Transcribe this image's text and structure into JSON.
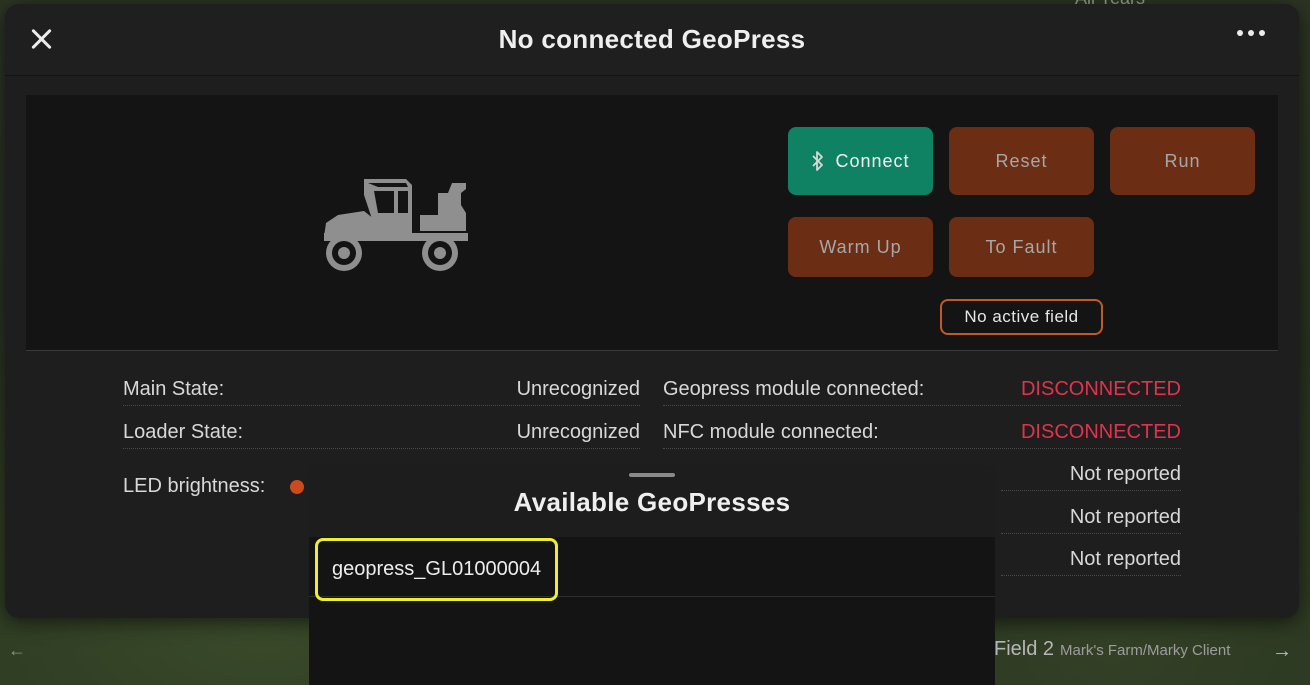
{
  "modal": {
    "title": "No connected GeoPress"
  },
  "buttons": {
    "connect": "Connect",
    "reset": "Reset",
    "run": "Run",
    "warm_up": "Warm Up",
    "to_fault": "To Fault"
  },
  "status_chip": "No active field",
  "info": {
    "main_state_label": "Main State:",
    "main_state_value": "Unrecognized",
    "loader_state_label": "Loader State:",
    "loader_state_value": "Unrecognized",
    "led_label": "LED brightness:",
    "geopress_module_label": "Geopress module connected:",
    "geopress_module_value": "DISCONNECTED",
    "nfc_module_label": "NFC module connected:",
    "nfc_module_value": "DISCONNECTED",
    "extra_values": [
      "Not reported",
      "Not reported",
      "Not reported"
    ]
  },
  "sheet": {
    "title": "Available GeoPresses",
    "items": [
      "geopress_GL01000004"
    ]
  },
  "background": {
    "top_text": "All Years",
    "field_name": "Field 2",
    "farm_client": "Mark's Farm/Marky Client"
  },
  "colors": {
    "connect_green": "#0f8264",
    "action_brown": "#6b2e15",
    "disconnected_red": "#e0334e",
    "highlight_yellow": "#f0f02a"
  },
  "icons": [
    "close-icon",
    "more-options-icon",
    "bluetooth-icon",
    "utv-vehicle-icon",
    "arrow-right-icon"
  ]
}
